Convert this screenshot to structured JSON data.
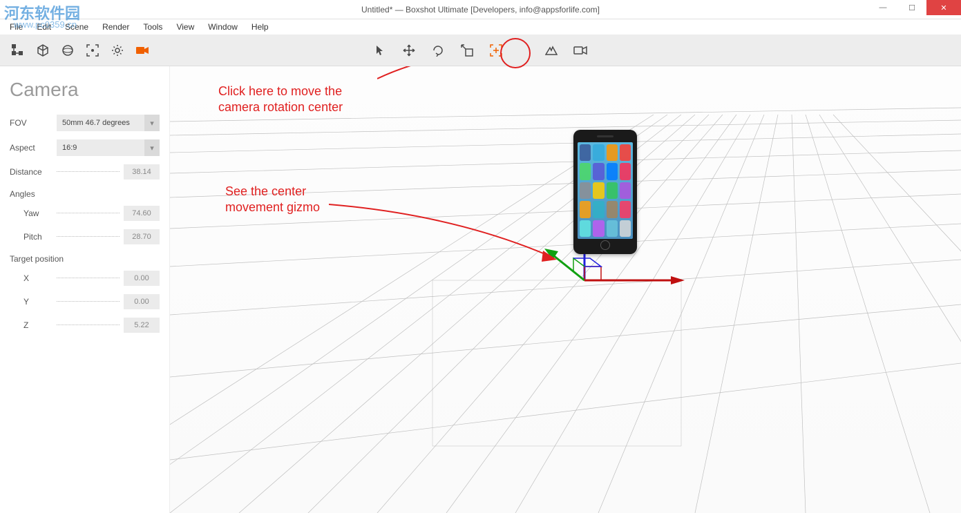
{
  "title": "Untitled* — Boxshot Ultimate [Developers, info@appsforlife.com]",
  "watermark": {
    "line1": "河东软件园",
    "line2": "www.pc0359.cn"
  },
  "menubar": [
    "File",
    "Edit",
    "Scene",
    "Render",
    "Tools",
    "View",
    "Window",
    "Help"
  ],
  "toolbar_left_icons": [
    "scene-tree",
    "object",
    "environment",
    "fit-view",
    "settings",
    "camera"
  ],
  "toolbar_center_icons": [
    "select",
    "move",
    "rotate",
    "scale",
    "camera-center",
    "sep",
    "render",
    "snapshot"
  ],
  "sidepanel": {
    "title": "Camera",
    "fov_label": "FOV",
    "fov_value": "50mm 46.7 degrees",
    "aspect_label": "Aspect",
    "aspect_value": "16:9",
    "distance_label": "Distance",
    "distance_value": "38.14",
    "angles_label": "Angles",
    "yaw_label": "Yaw",
    "yaw_value": "74.60",
    "pitch_label": "Pitch",
    "pitch_value": "28.70",
    "target_label": "Target position",
    "x_label": "X",
    "x_value": "0.00",
    "y_label": "Y",
    "y_value": "0.00",
    "z_label": "Z",
    "z_value": "5.22"
  },
  "annotations": {
    "a1": "Click here to move the\ncamera rotation center",
    "a2": "See the center\nmovement gizmo"
  }
}
